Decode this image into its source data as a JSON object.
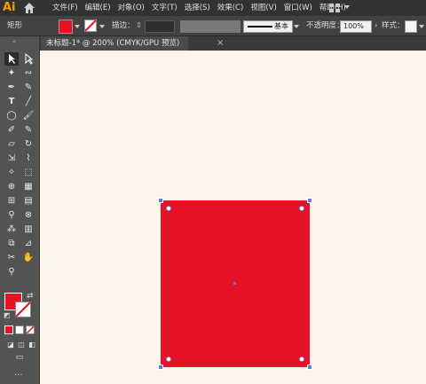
{
  "app": {
    "logo": "Ai",
    "menu": [
      "文件(F)",
      "编辑(E)",
      "对象(O)",
      "文字(T)",
      "选择(S)",
      "效果(C)",
      "视图(V)",
      "窗口(W)",
      "帮助(H)"
    ]
  },
  "control": {
    "object_label": "矩形",
    "stroke_label": "描边：",
    "stroke_style": "基本",
    "opacity_label": "不透明度：",
    "opacity_value": "100%",
    "style_label": "样式："
  },
  "document": {
    "tab_title": "未标题-1* @ 200% (CMYK/GPU 预览)",
    "close_symbol": "×"
  },
  "colors": {
    "fill": "#e61226",
    "stroke": "none",
    "canvas": "#fdf5ec"
  },
  "tools": {
    "more": "..."
  }
}
